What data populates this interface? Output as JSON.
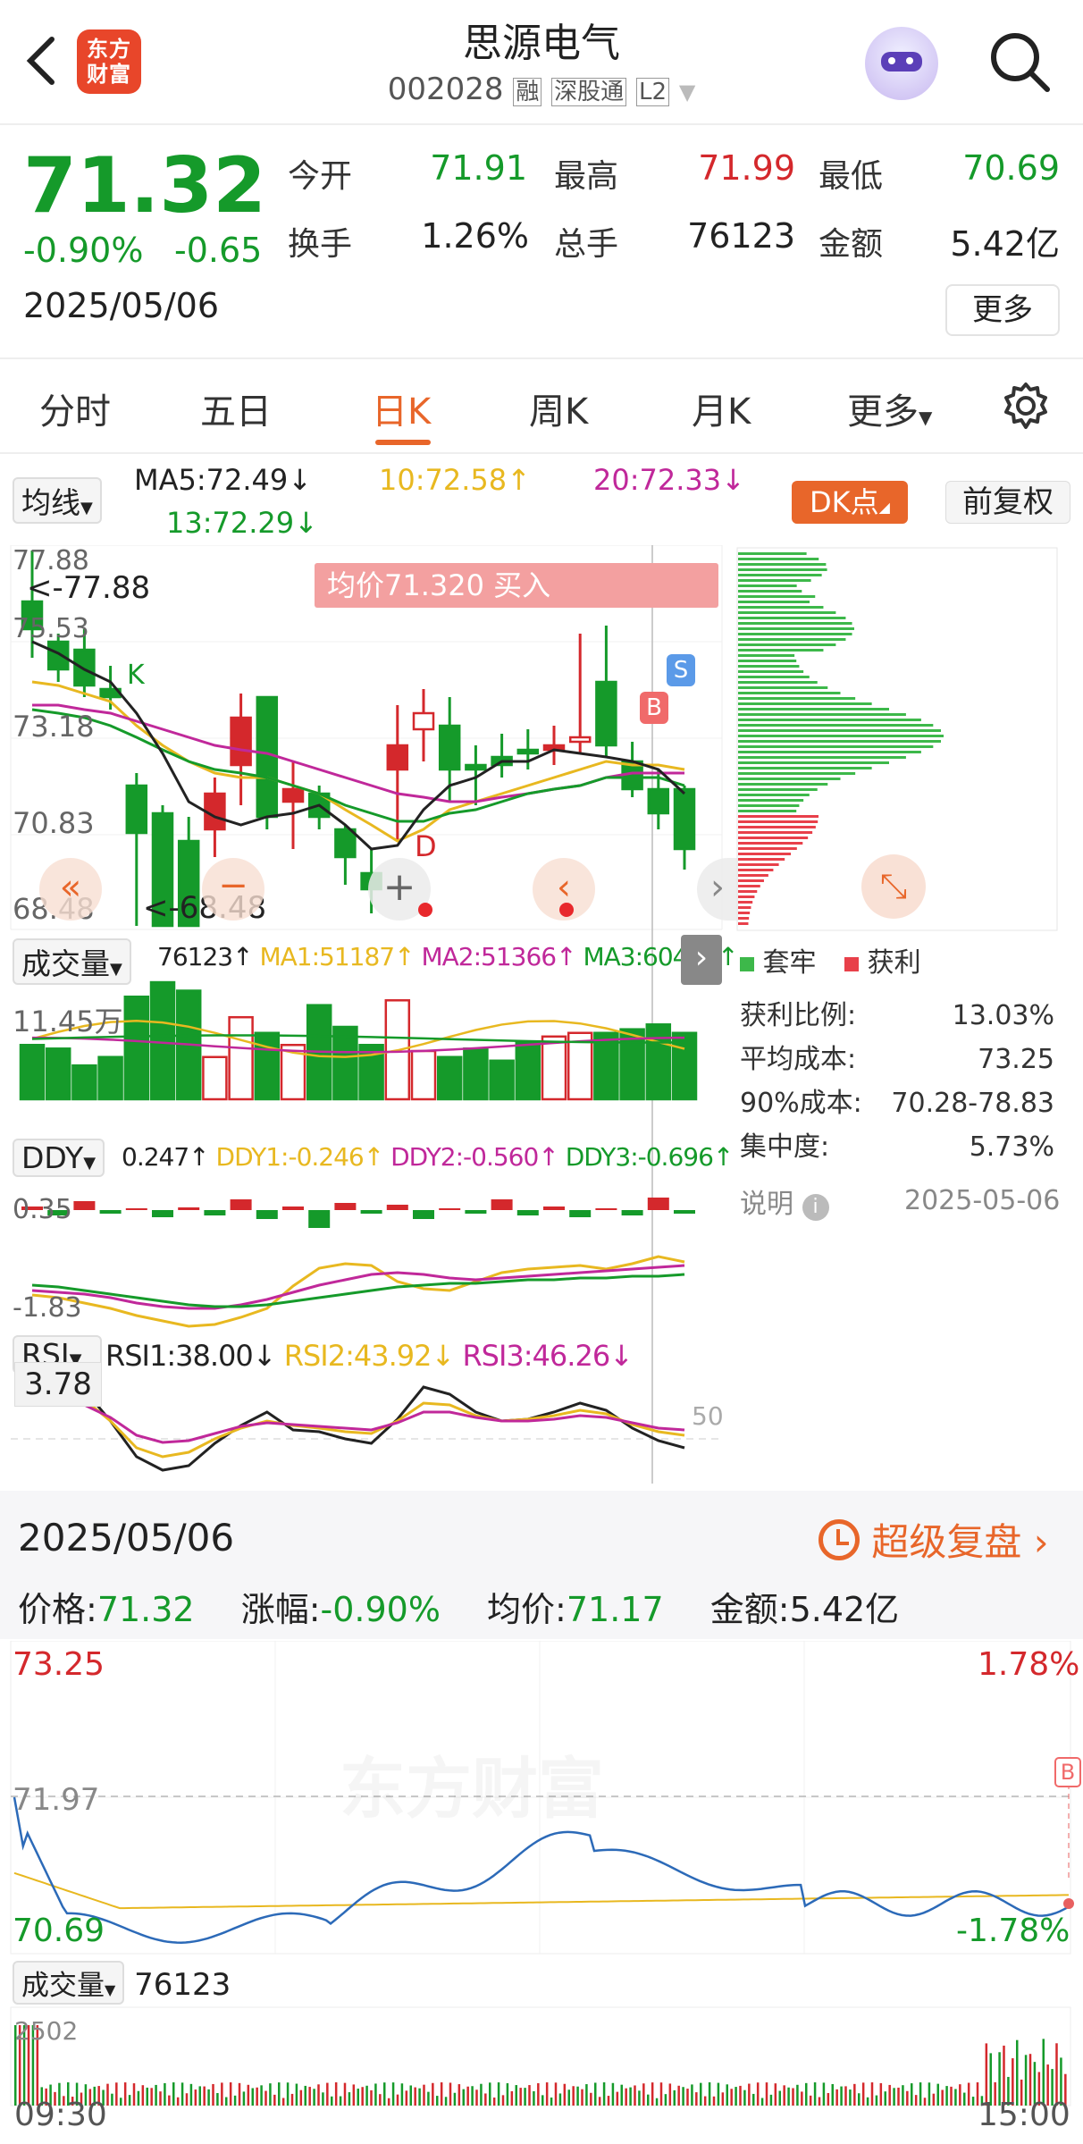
{
  "header": {
    "name": "思源电气",
    "code": "002028",
    "tags": [
      "融",
      "深股通",
      "L2"
    ],
    "logo_text": "东方财富"
  },
  "quote": {
    "price": "71.32",
    "pct": "-0.90%",
    "chg": "-0.65",
    "date": "2025/05/06",
    "stats": [
      {
        "l": "今开",
        "v": "71.91"
      },
      {
        "l": "最高",
        "v": "71.99"
      },
      {
        "l": "最低",
        "v": "70.69"
      },
      {
        "l": "换手",
        "v": "1.26%"
      },
      {
        "l": "总手",
        "v": "76123"
      },
      {
        "l": "金额",
        "v": "5.42亿"
      }
    ],
    "more": "更多"
  },
  "tabs": [
    "分时",
    "五日",
    "日K",
    "周K",
    "月K",
    "更多"
  ],
  "ma": {
    "sel": "均线",
    "ma5": "MA5:72.49↓",
    "ma10": "10:72.58↑",
    "ma20": "20:72.33↓",
    "ma13": "13:72.29↓",
    "dk": "DK点",
    "fq": "前复权"
  },
  "kchart": {
    "ticks": [
      "77.88",
      "75.53",
      "73.18",
      "70.83",
      "68.48"
    ],
    "max_label": "<-77.88",
    "min_label": "<-68.48",
    "banner": "均价71.320 买入",
    "b": "B",
    "s": "S",
    "d": "D",
    "k": "K"
  },
  "vol": {
    "sel": "成交量",
    "vals": "76123↑",
    "ma1": "MA1:51187↑",
    "ma2": "MA2:51366↑",
    "ma3": "MA3:60464↑",
    "top": "11.45万"
  },
  "ddy": {
    "sel": "DDY",
    "vals": "0.247↑",
    "d1": "DDY1:-0.246↑",
    "d2": "DDY2:-0.560↑",
    "d3": "DDY3:-0.696↑",
    "top": "0.35",
    "bot": "-1.83"
  },
  "rsi": {
    "sel": "RSI",
    "r1": "RSI1:38.00↓",
    "r2": "RSI2:43.92↓",
    "r3": "RSI3:46.26↓",
    "badge": "3.78",
    "fifty": "50"
  },
  "chips": {
    "legend1": "套牢",
    "legend2": "获利",
    "rows": [
      {
        "l": "获利比例:",
        "v": "13.03%"
      },
      {
        "l": "平均成本:",
        "v": "73.25"
      },
      {
        "l": "90%成本:",
        "v": "70.28-78.83"
      },
      {
        "l": "集中度:",
        "v": "5.73%"
      }
    ],
    "note": "说明",
    "date": "2025-05-06"
  },
  "day": {
    "date": "2025/05/06",
    "replay": "超级复盘",
    "price_l": "价格:",
    "price": "71.32",
    "pct_l": "涨幅:",
    "pct": "-0.90%",
    "avg_l": "均价:",
    "avg": "71.17",
    "amt_l": "金额:",
    "amt": "5.42亿",
    "tl": "73.25",
    "tr": "1.78%",
    "mid": "71.97",
    "bl": "70.69",
    "br": "-1.78%",
    "b": "B",
    "vol_sel": "成交量",
    "vol": "76123",
    "vol_top": "2502",
    "t0": "09:30",
    "t1": "15:00",
    "wm": "东方财富"
  },
  "colors": {
    "up": "#d4282c",
    "down": "#159a2a",
    "orange": "#e8662a",
    "ma5": "#222222",
    "ma10": "#e8b820",
    "ma20": "#c0289a",
    "ma13": "#159a2a"
  }
}
